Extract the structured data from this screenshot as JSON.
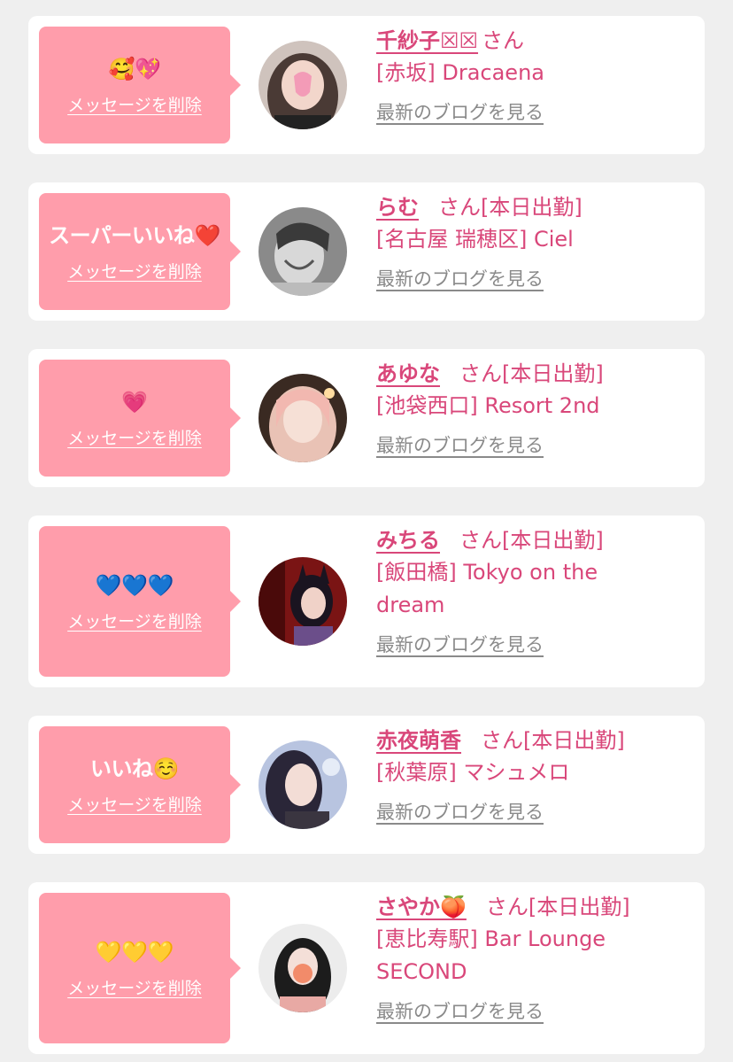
{
  "colors": {
    "accent": "#d9477a",
    "bubble": "#ff9dab",
    "link_gray": "#8a8a8a",
    "background": "#efefef"
  },
  "common": {
    "delete_label": "メッセージを削除",
    "blog_label": "最新のブログを見る"
  },
  "items": [
    {
      "reaction_text": "",
      "reaction_emoji": "🥰💖",
      "name": "千紗子☒☒",
      "suffix": "さん",
      "shop": "[赤坂] Dracaena"
    },
    {
      "reaction_text": "スーパーいいね",
      "reaction_emoji": "❤️",
      "name": "らむ",
      "suffix": "さん[本日出勤]",
      "shop": "[名古屋 瑞穂区] Ciel"
    },
    {
      "reaction_text": "",
      "reaction_emoji": "💗",
      "name": "あゆな",
      "suffix": "さん[本日出勤]",
      "shop": "[池袋西口] Resort 2nd"
    },
    {
      "reaction_text": "",
      "reaction_emoji": "💙💙💙",
      "name": "みちる",
      "suffix": "さん[本日出勤]",
      "shop": "[飯田橋] Tokyo on the dream"
    },
    {
      "reaction_text": "いいね",
      "reaction_emoji": "☺️",
      "name": "赤夜萌香",
      "suffix": "さん[本日出勤]",
      "shop": "[秋葉原] マシュメロ"
    },
    {
      "reaction_text": "",
      "reaction_emoji": "💛💛💛",
      "name": "さやか🍑",
      "suffix": "さん[本日出勤]",
      "shop": "[恵比寿駅] Bar Lounge SECOND"
    }
  ]
}
